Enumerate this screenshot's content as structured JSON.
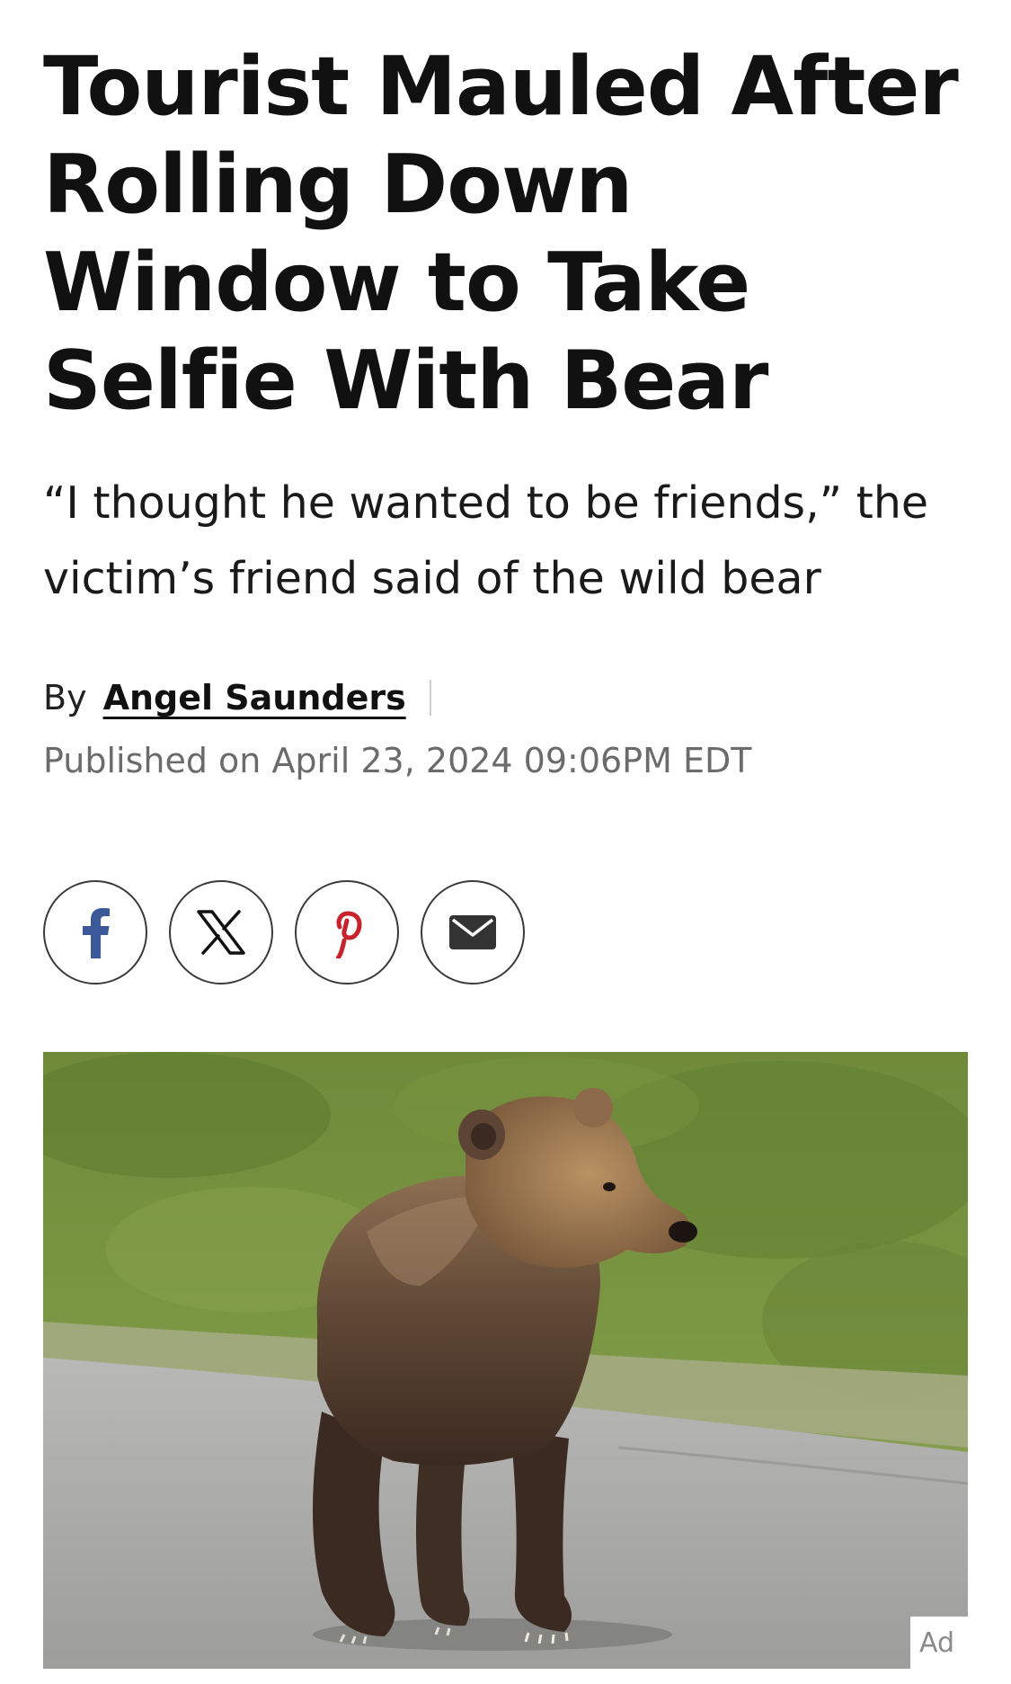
{
  "article": {
    "headline": "Tourist Mauled After Rolling Down Window to Take Selfie With Bear",
    "dek": "“I thought he wanted to be friends,” the victim’s friend said of the wild bear",
    "byline_prefix": "By",
    "author": "Angel Saunders",
    "published": "Published on April 23, 2024 09:06PM EDT"
  },
  "share": [
    {
      "network": "facebook",
      "icon": "facebook-icon",
      "color": "#3b5998"
    },
    {
      "network": "x",
      "icon": "x-icon",
      "color": "#111111"
    },
    {
      "network": "pinterest",
      "icon": "pinterest-icon",
      "color": "#c8232c"
    },
    {
      "network": "email",
      "icon": "email-icon",
      "color": "#333333"
    }
  ],
  "photo": {
    "subject": "brown bear walking on a road"
  },
  "ad_label": "Ad"
}
